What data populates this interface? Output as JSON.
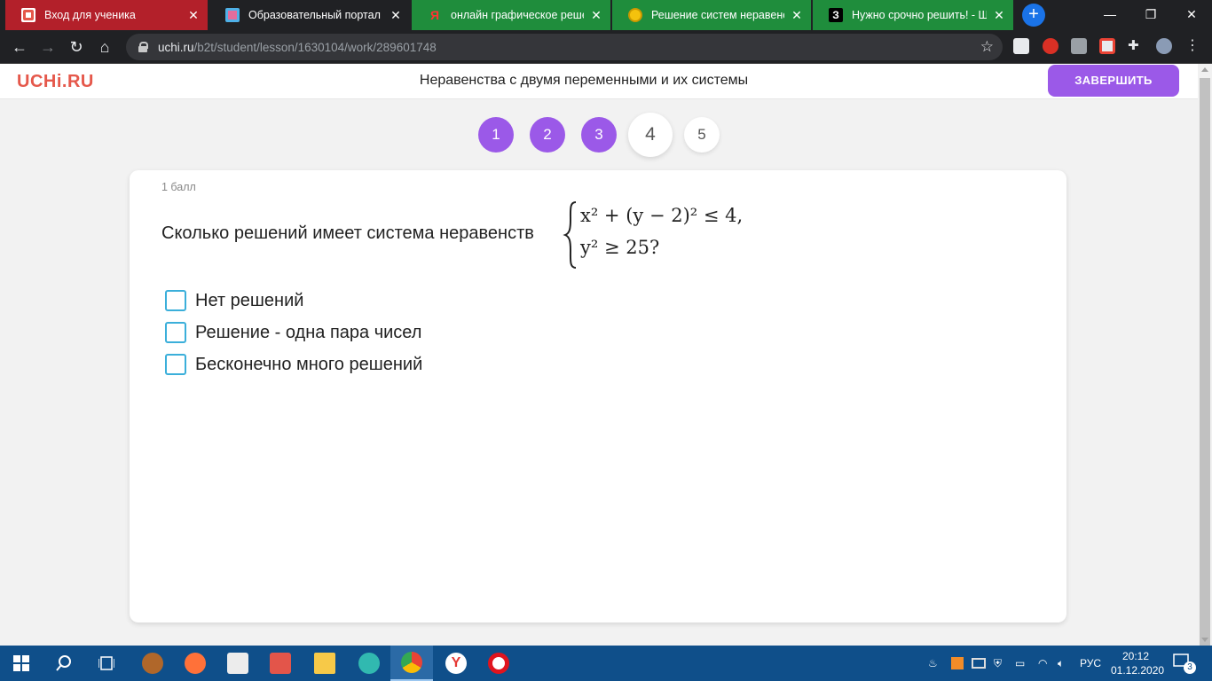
{
  "browser": {
    "tabs": [
      {
        "title": "Вход для ученика"
      },
      {
        "title": "Образовательный портал на"
      },
      {
        "title": "онлайн графическое решени"
      },
      {
        "title": "Решение систем неравенств"
      },
      {
        "title": "Нужно срочно решить! - Шко"
      }
    ],
    "url_host": "uchi.ru",
    "url_path": "/b2t/student/lesson/1630104/work/289601748"
  },
  "header": {
    "logo": "UCHi.RU",
    "title": "Неравенства с двумя переменными и их системы",
    "finish_label": "ЗАВЕРШИТЬ"
  },
  "pager": {
    "pages": [
      {
        "label": "1",
        "state": "done"
      },
      {
        "label": "2",
        "state": "done"
      },
      {
        "label": "3",
        "state": "done"
      },
      {
        "label": "4",
        "state": "current"
      },
      {
        "label": "5",
        "state": "todo"
      }
    ]
  },
  "task": {
    "score": "1 балл",
    "question": "Сколько решений имеет система неравенств",
    "formula": {
      "line1": "x² + (y − 2)² ≤ 4,",
      "line2": "y² ≥ 25?"
    },
    "answers": [
      {
        "label": "Нет решений",
        "checked": false
      },
      {
        "label": "Решение - одна пара чисел",
        "checked": false
      },
      {
        "label": "Бесконечно много решений",
        "checked": false
      }
    ]
  },
  "taskbar": {
    "language": "РУС",
    "time": "20:12",
    "date": "01.12.2020",
    "notifications": "3"
  },
  "colors": {
    "accent_purple": "#9b59e8",
    "logo_red": "#e5584b",
    "checkbox_blue": "#3bafda",
    "taskbar_blue": "#0f4f8a"
  }
}
